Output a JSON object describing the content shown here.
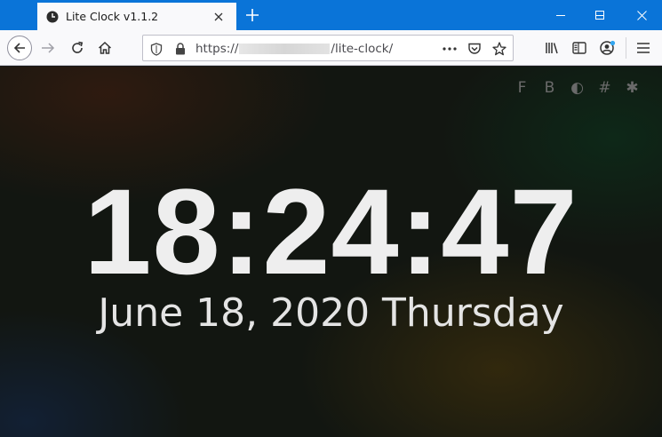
{
  "browser": {
    "tab": {
      "title": "Lite Clock v1.1.2",
      "icon": "clock-icon"
    },
    "new_tab_icon": "plus-icon",
    "window_controls": [
      "minimize-icon",
      "maximize-icon",
      "close-icon"
    ],
    "nav": {
      "back_icon": "arrow-left-icon",
      "forward_icon": "arrow-right-icon",
      "reload_icon": "reload-icon",
      "home_icon": "home-icon"
    },
    "url": {
      "prefix": "https://",
      "path": "/lite-clock/"
    },
    "url_icons": [
      "shield-icon",
      "lock-icon",
      "more-icon",
      "pocket-icon",
      "star-icon"
    ],
    "toolbar_icons": [
      "library-icon",
      "sidebar-icon",
      "account-icon",
      "menu-icon"
    ],
    "accent": "#0a74d8"
  },
  "page": {
    "toolbar": {
      "f": "F",
      "b": "B",
      "theme": "◐",
      "hash": "#",
      "star": "✱"
    },
    "time": "18:24:47",
    "date": "June 18, 2020 Thursday"
  }
}
